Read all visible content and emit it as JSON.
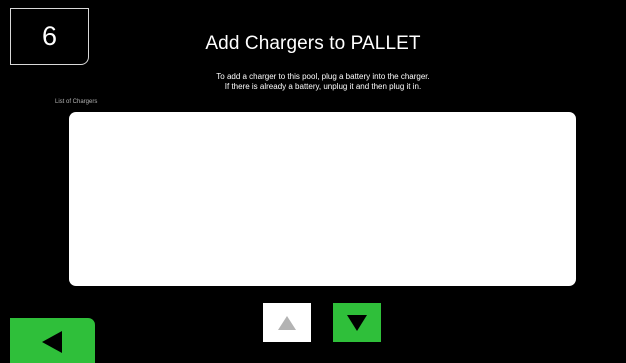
{
  "header": {
    "step_number": "6",
    "title": "Add Chargers to PALLET"
  },
  "instructions": {
    "line1": "To add a charger to this pool, plug a battery into the charger.",
    "line2": "If there is already a battery, unplug it and then plug it in."
  },
  "charger_list": {
    "label": "List of Chargers",
    "items": []
  },
  "controls": {
    "scroll_up_icon": "triangle-up-icon",
    "scroll_down_icon": "triangle-down-icon",
    "back_icon": "triangle-left-icon"
  },
  "colors": {
    "background": "#000000",
    "accent_green": "#2fbf3a",
    "list_background": "#ffffff",
    "disabled_arrow": "#b3b3b3"
  }
}
